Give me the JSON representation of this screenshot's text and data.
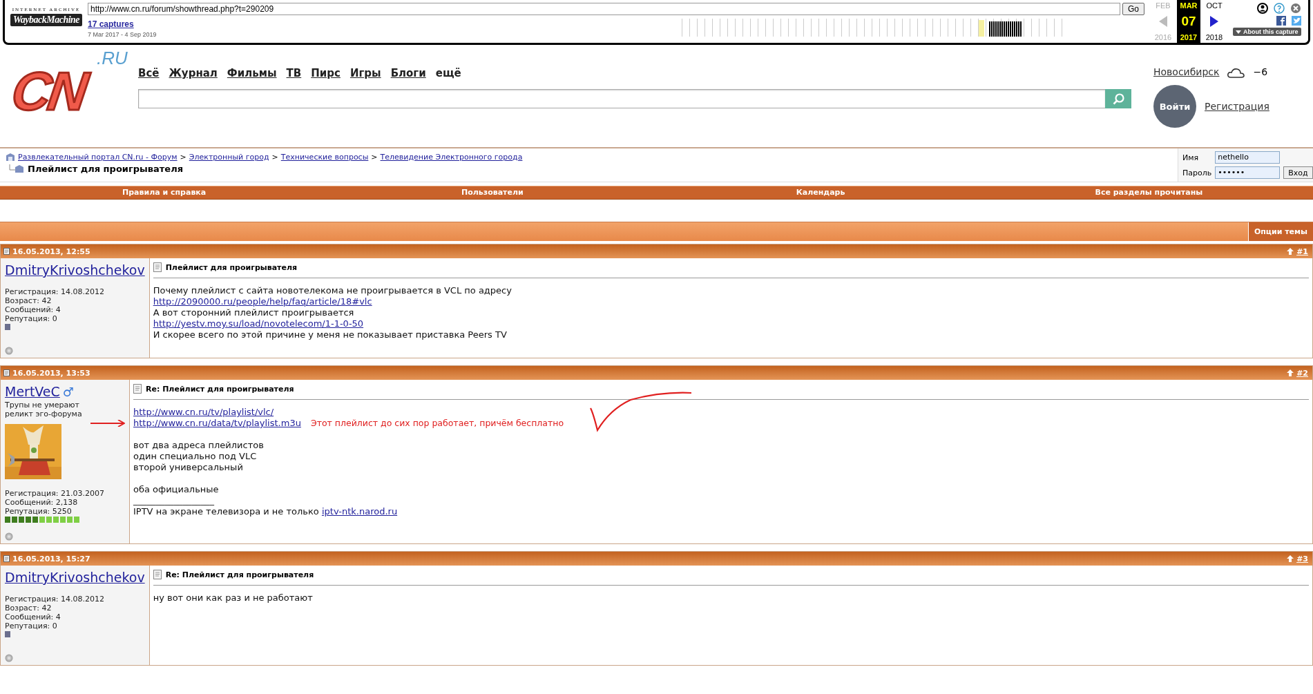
{
  "wayback": {
    "logo_top": "INTERNET ARCHIVE",
    "logo": "WaybackMachine",
    "url": "http://www.cn.ru/forum/showthread.php?t=290209",
    "go": "Go",
    "captures": "17 captures",
    "range": "7 Mar 2017 - 4 Sep 2019",
    "months": [
      {
        "month": "FEB",
        "year": "2016",
        "selected": false
      },
      {
        "month": "MAR",
        "day": "07",
        "year": "2017",
        "selected": true
      },
      {
        "month": "OCT",
        "year": "2018",
        "selected": false
      }
    ],
    "about": "About this capture"
  },
  "site": {
    "logo": "CN",
    "logo_suffix": ".RU",
    "nav": [
      "Всё",
      "Журнал",
      "Фильмы",
      "ТВ",
      "Пирс",
      "Игры",
      "Блоги",
      "ещё"
    ],
    "city": "Новосибирск",
    "temperature": "−6",
    "login": "Войти",
    "register": "Регистрация"
  },
  "breadcrumb": {
    "links": [
      "Развлекательный портал CN.ru - Форум",
      "Электронный город",
      "Технические вопросы",
      "Телевидение Электронного города"
    ],
    "separators": [
      ">",
      ">",
      ">"
    ],
    "title": "Плейлист для проигрывателя"
  },
  "login_form": {
    "name_label": "Имя",
    "name_value": "nethello",
    "password_label": "Пароль",
    "password_value": "••••••",
    "submit": "Вход"
  },
  "navbar": [
    "Правила и справка",
    "Пользователи",
    "Календарь",
    "Все разделы прочитаны"
  ],
  "thread_options": "Опции темы",
  "posts": [
    {
      "date": "16.05.2013, 12:55",
      "number": "#1",
      "author": "DmitryKrivoshchekov",
      "stats": [
        "Регистрация: 14.08.2012",
        "Возраст: 42",
        "Сообщений: 4",
        "Репутация: 0"
      ],
      "reputation": [
        {
          "color": "#6b6f8e"
        }
      ],
      "title": "Плейлист для проигрывателя",
      "lines": [
        {
          "kind": "text",
          "text": "Почему плейлист с сайта новотелекома не проигрывается в VCL по адресу"
        },
        {
          "kind": "link",
          "text": "http://2090000.ru/people/help/faq/article/18#vlc"
        },
        {
          "kind": "text",
          "text": "А вот сторонний плейлист проигрывается"
        },
        {
          "kind": "link",
          "text": "http://yestv.moy.su/load/novotelecom/1-1-0-50"
        },
        {
          "kind": "text",
          "text": "И скорее всего по этой причине у меня не показывает приставка Peers TV"
        }
      ]
    },
    {
      "date": "16.05.2013, 13:53",
      "number": "#2",
      "author": "MertVeC",
      "gender_symbol": "♂",
      "user_title": [
        "Трупы не умерают",
        "реликт эго-форума"
      ],
      "avatar": {
        "kind": "picture"
      },
      "stats": [
        "Регистрация: 21.03.2007",
        "Сообщений: 2,138",
        "Репутация: 5250"
      ],
      "reputation": [
        {
          "color": "#3f7d1f"
        },
        {
          "color": "#3f7d1f"
        },
        {
          "color": "#3f7d1f"
        },
        {
          "color": "#3f7d1f"
        },
        {
          "color": "#3f7d1f"
        },
        {
          "color": "#7fcf45"
        },
        {
          "color": "#7fcf45"
        },
        {
          "color": "#7fcf45"
        },
        {
          "color": "#7fcf45"
        },
        {
          "color": "#7fcf45"
        },
        {
          "color": "#7fcf45"
        }
      ],
      "title": "Re: Плейлист для проигрывателя",
      "lines": [
        {
          "kind": "link",
          "text": "http://www.cn.ru/tv/playlist/vlc/"
        },
        {
          "kind": "link",
          "text": "http://www.cn.ru/data/tv/playlist.m3u",
          "note": "Этот плейлист до сих пор работает, причём бесплатно",
          "arrow": true,
          "check_mark": true
        },
        {
          "kind": "blank"
        },
        {
          "kind": "text",
          "text": "вот два адреса плейлистов"
        },
        {
          "kind": "text",
          "text": "один специально под VLC"
        },
        {
          "kind": "text",
          "text": "второй универсальный"
        },
        {
          "kind": "blank"
        },
        {
          "kind": "text",
          "text": "оба официальные"
        },
        {
          "kind": "text",
          "text": "__________________"
        },
        {
          "kind": "signature",
          "text": "IPTV на экране телевизора и не только ",
          "link": "iptv-ntk.narod.ru"
        }
      ]
    },
    {
      "date": "16.05.2013, 15:27",
      "number": "#3",
      "author": "DmitryKrivoshchekov",
      "stats": [
        "Регистрация: 14.08.2012",
        "Возраст: 42",
        "Сообщений: 4",
        "Репутация: 0"
      ],
      "reputation": [
        {
          "color": "#6b6f8e"
        }
      ],
      "title": "Re: Плейлист для проигрывателя",
      "lines": [
        {
          "kind": "text",
          "text": "ну вот они как раз и не работают"
        }
      ]
    }
  ]
}
